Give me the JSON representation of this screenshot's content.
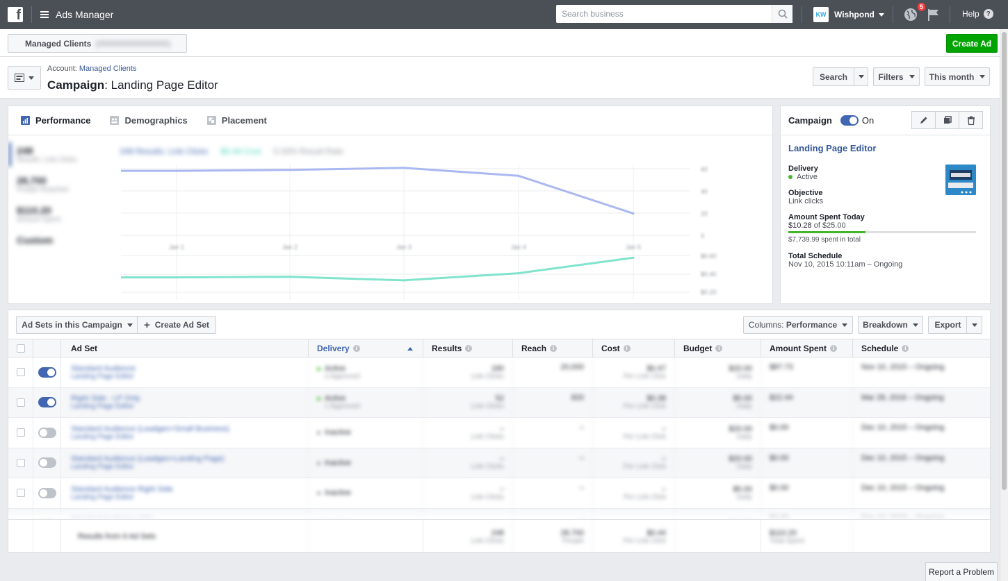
{
  "topbar": {
    "app_title": "Ads Manager",
    "search_placeholder": "Search business",
    "account_initials": "KW",
    "account_name": "Wishpond",
    "notification_count": "5",
    "help_label": "Help"
  },
  "account_bar": {
    "managed_clients_label": "Managed Clients",
    "managed_clients_id": "(000000000000000)",
    "create_ad_label": "Create Ad"
  },
  "header": {
    "breadcrumb_prefix": "Account:",
    "breadcrumb_link": "Managed Clients",
    "title_bold": "Campaign",
    "title_rest": ": Landing Page Editor",
    "search_btn": "Search",
    "filters_btn": "Filters",
    "date_btn": "This month"
  },
  "performance": {
    "tabs": [
      {
        "label": "Performance",
        "icon": "bar-chart-icon"
      },
      {
        "label": "Demographics",
        "icon": "people-icon"
      },
      {
        "label": "Placement",
        "icon": "placement-icon"
      }
    ],
    "metrics": [
      {
        "value": "248",
        "label": "Results: Link Clicks"
      },
      {
        "value": "28,700",
        "label": "People Reached"
      },
      {
        "value": "$110.20",
        "label": "Amount Spent"
      },
      {
        "value": "Custom",
        "label": ""
      }
    ],
    "legend": {
      "results": "248 Results: Link Clicks",
      "cost": "$0.44 Cost",
      "rate": "0.33% Result Rate"
    }
  },
  "chart_data": {
    "type": "line",
    "x": [
      "Jan 1",
      "Jan 2",
      "Jan 3",
      "Jan 4",
      "Jan 5"
    ],
    "series": [
      {
        "values": [
          65,
          66,
          68,
          60,
          22
        ],
        "color": "#a9b8f0"
      },
      {
        "values": [
          0.25,
          0.26,
          0.2,
          0.32,
          0.58
        ],
        "color": "#7fe3cd"
      }
    ],
    "y_ticks_top": [
      "60",
      "40",
      "20",
      "0"
    ],
    "y_ticks_bottom": [
      "$0.60",
      "$0.40",
      "$0.20"
    ],
    "grid": true
  },
  "campaign": {
    "label": "Campaign",
    "status": "On",
    "name": "Landing Page Editor",
    "delivery_label": "Delivery",
    "delivery_value": "Active",
    "objective_label": "Objective",
    "objective_value": "Link clicks",
    "spent_today_label": "Amount Spent Today",
    "spent_today_value": "$10.28",
    "spent_today_of": "of $25.00",
    "spent_fraction": 0.411,
    "spent_total": "$7,739.99 spent in total",
    "schedule_label": "Total Schedule",
    "schedule_value": "Nov 10, 2015 10:11am – Ongoing"
  },
  "table": {
    "adsets_btn": "Ad Sets in this Campaign",
    "create_adset_btn": "Create Ad Set",
    "columns_prefix": "Columns:",
    "columns_value": "Performance",
    "breakdown_btn": "Breakdown",
    "export_btn": "Export",
    "headers": [
      "Ad Set",
      "Delivery",
      "Results",
      "Reach",
      "Cost",
      "Budget",
      "Amount Spent",
      "Schedule"
    ],
    "rows": [
      {
        "on": true,
        "name": "Standard Audience",
        "sub": "Landing Page Editor",
        "delivery": "Active",
        "delivery_sub": "2 Approved",
        "results": "180",
        "results_sub": "Link Clicks",
        "reach": "20,000",
        "cost": "$0.47",
        "cost_sub": "Per Link Click",
        "budget": "$20.00",
        "budget_sub": "Daily",
        "spent": "$87.73",
        "schedule": "Nov 10, 2015 – Ongoing"
      },
      {
        "on": true,
        "name": "Right Side - LP Only",
        "sub": "Landing Page Editor",
        "delivery": "Active",
        "delivery_sub": "1 Approved",
        "results": "52",
        "results_sub": "Link Clicks",
        "reach": "820",
        "cost": "$0.38",
        "cost_sub": "Per Link Click",
        "budget": "$5.00",
        "budget_sub": "Daily",
        "spent": "$22.44",
        "schedule": "Mar 28, 2016 – Ongoing"
      },
      {
        "on": false,
        "name": "Standard Audience (Leadgen+Small Business)",
        "sub": "Landing Page Editor",
        "delivery": "Inactive",
        "delivery_sub": "",
        "results": "–",
        "results_sub": "Link Clicks",
        "reach": "–",
        "cost": "–",
        "cost_sub": "Per Link Click",
        "budget": "$20.00",
        "budget_sub": "Daily",
        "spent": "$0.00",
        "schedule": "Dec 10, 2015 – Ongoing"
      },
      {
        "on": false,
        "name": "Standard Audience (Leadgen+Landing Page)",
        "sub": "Landing Page Editor",
        "delivery": "Inactive",
        "delivery_sub": "",
        "results": "–",
        "results_sub": "Link Clicks",
        "reach": "–",
        "cost": "–",
        "cost_sub": "Per Link Click",
        "budget": "$20.00",
        "budget_sub": "Daily",
        "spent": "$0.00",
        "schedule": "Dec 10, 2015 – Ongoing"
      },
      {
        "on": false,
        "name": "Standard Audience Right Side",
        "sub": "Landing Page Editor",
        "delivery": "Inactive",
        "delivery_sub": "",
        "results": "–",
        "results_sub": "Link Clicks",
        "reach": "–",
        "cost": "–",
        "cost_sub": "Per Link Click",
        "budget": "$5.00",
        "budget_sub": "Daily",
        "spent": "$0.00",
        "schedule": "Dec 10, 2015 – Ongoing"
      },
      {
        "on": false,
        "name": "Standard Audience CPC",
        "sub": "Landing Page Editor",
        "delivery": "Inactive",
        "delivery_sub": "",
        "results": "–",
        "results_sub": "",
        "reach": "–",
        "cost": "–",
        "cost_sub": "",
        "budget": "$10.00",
        "budget_sub": "",
        "spent": "$0.00",
        "schedule": "Dec 10, 2015 – Ongoing"
      }
    ],
    "summary": {
      "label": "Results from 6 Ad Sets",
      "results": "248",
      "results_sub": "Link Clicks",
      "reach": "28,700",
      "reach_sub": "People",
      "cost": "$0.44",
      "cost_sub": "Per Link Click",
      "spent": "$110.20",
      "spent_sub": "Total Spent"
    }
  },
  "report_problem": "Report a Problem"
}
